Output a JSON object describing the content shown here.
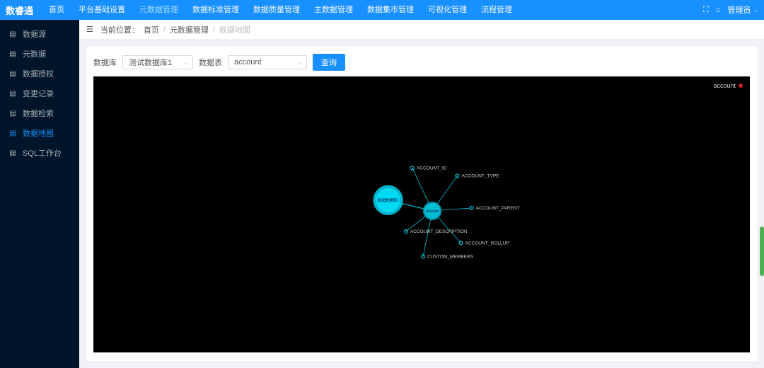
{
  "header": {
    "logo": "数睿通",
    "nav": [
      {
        "label": "首页",
        "active": false
      },
      {
        "label": "平台基础设置",
        "active": false
      },
      {
        "label": "元数据管理",
        "active": true
      },
      {
        "label": "数据标准管理",
        "active": false
      },
      {
        "label": "数据质量管理",
        "active": false
      },
      {
        "label": "主数据管理",
        "active": false
      },
      {
        "label": "数据集市管理",
        "active": false
      },
      {
        "label": "可视化管理",
        "active": false
      },
      {
        "label": "流程管理",
        "active": false
      }
    ],
    "user": "管理员"
  },
  "sidebar": {
    "items": [
      {
        "label": "数据源",
        "active": false
      },
      {
        "label": "元数据",
        "active": false
      },
      {
        "label": "数据授权",
        "active": false
      },
      {
        "label": "变更记录",
        "active": false
      },
      {
        "label": "数据检索",
        "active": false
      },
      {
        "label": "数据地图",
        "active": true
      },
      {
        "label": "SQL工作台",
        "active": false
      }
    ]
  },
  "breadcrumb": {
    "label": "当前位置：",
    "items": [
      "首页",
      "元数据管理",
      "数据地图"
    ]
  },
  "filters": {
    "database_label": "数据库",
    "database_value": "测试数据库1",
    "table_label": "数据表",
    "table_value": "account",
    "query_button": "查询"
  },
  "viz": {
    "legend_label": "account",
    "center_db": "测试数据库1",
    "center_table": "account",
    "columns": [
      "ACCOUNT_ID",
      "ACCOUNT_TYPE",
      "ACCOUNT_PARENT",
      "ACCOUNT_DESCRIPTION",
      "ACCOUNT_ROLLUP",
      "CUSTOM_MEMBERS"
    ]
  }
}
